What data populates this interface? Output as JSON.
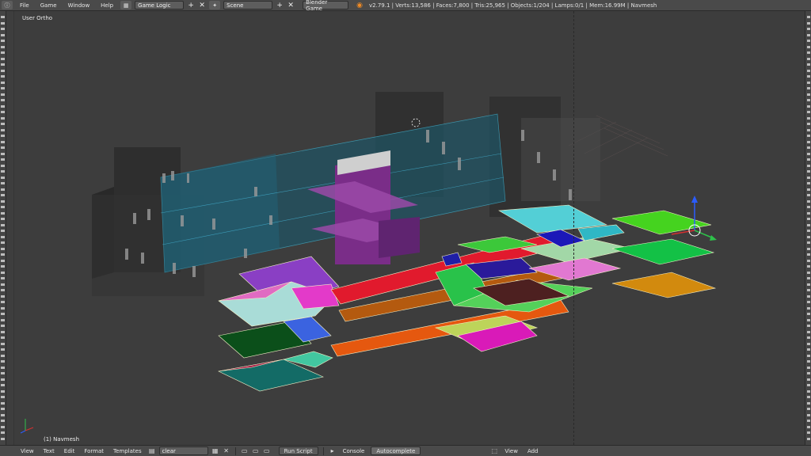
{
  "top_menu": {
    "items": [
      "File",
      "Game",
      "Window",
      "Help"
    ],
    "screen_layout": "Game Logic",
    "scene": "Scene",
    "engine": "Blender Game",
    "stats": "v2.79.1 | Verts:13,586 | Faces:7,800 | Tris:25,965 | Objects:1/204 | Lamps:0/1 | Mem:16.99M | Navmesh"
  },
  "viewport": {
    "view_name": "User Ortho",
    "active_object": "(1) Navmesh"
  },
  "text_editor_header": {
    "items": [
      "View",
      "Text",
      "Edit",
      "Format",
      "Templates"
    ],
    "text_name": "clear",
    "run_script": "Run Script"
  },
  "console_header": {
    "label": "Console",
    "autocomplete": "Autocomplete"
  },
  "view3d_header": {
    "items": [
      "View",
      "Add"
    ]
  },
  "colors": {
    "accent": "#f08a24",
    "background": "#3d3d3d"
  }
}
